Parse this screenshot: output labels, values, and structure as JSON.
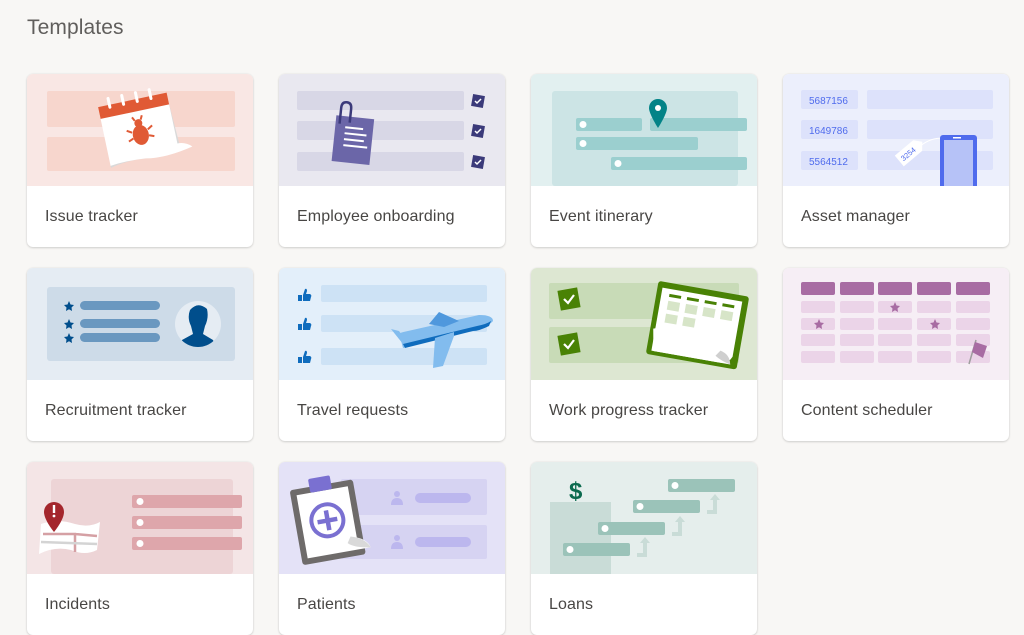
{
  "page": {
    "title": "Templates"
  },
  "templates": [
    {
      "label": "Issue tracker",
      "bg": "#f9e7e4",
      "accent": "#e05a35",
      "icon": "calendar-bug-icon"
    },
    {
      "label": "Employee onboarding",
      "bg": "#e9e8f0",
      "accent": "#403a7a",
      "icon": "clipboard-checklist-icon"
    },
    {
      "label": "Event itinerary",
      "bg": "#e2f0f0",
      "accent": "#038387",
      "icon": "map-pin-icon"
    },
    {
      "label": "Asset manager",
      "bg": "#eceffc",
      "accent": "#4f6bed",
      "icon": "phone-tag-icon",
      "asset_ids": [
        "5687156",
        "1649786",
        "5564512"
      ],
      "tag_number": "3254"
    },
    {
      "label": "Recruitment tracker",
      "bg": "#e5ecf3",
      "accent": "#004e8c",
      "icon": "person-profile-icon"
    },
    {
      "label": "Travel requests",
      "bg": "#e3effa",
      "accent": "#0f6cbd",
      "icon": "airplane-icon"
    },
    {
      "label": "Work progress tracker",
      "bg": "#dde7d2",
      "accent": "#498205",
      "icon": "calendar-check-icon"
    },
    {
      "label": "Content scheduler",
      "bg": "#f6eef5",
      "accent": "#a05a9c",
      "icon": "calendar-flag-icon"
    },
    {
      "label": "Incidents",
      "bg": "#f4e5e6",
      "accent": "#a4262c",
      "icon": "map-alert-icon"
    },
    {
      "label": "Patients",
      "bg": "#e4e2f7",
      "accent": "#7a70d1",
      "icon": "clipboard-medical-icon"
    },
    {
      "label": "Loans",
      "bg": "#e5eeec",
      "accent": "#0b6a4e",
      "icon": "dollar-steps-icon"
    }
  ]
}
